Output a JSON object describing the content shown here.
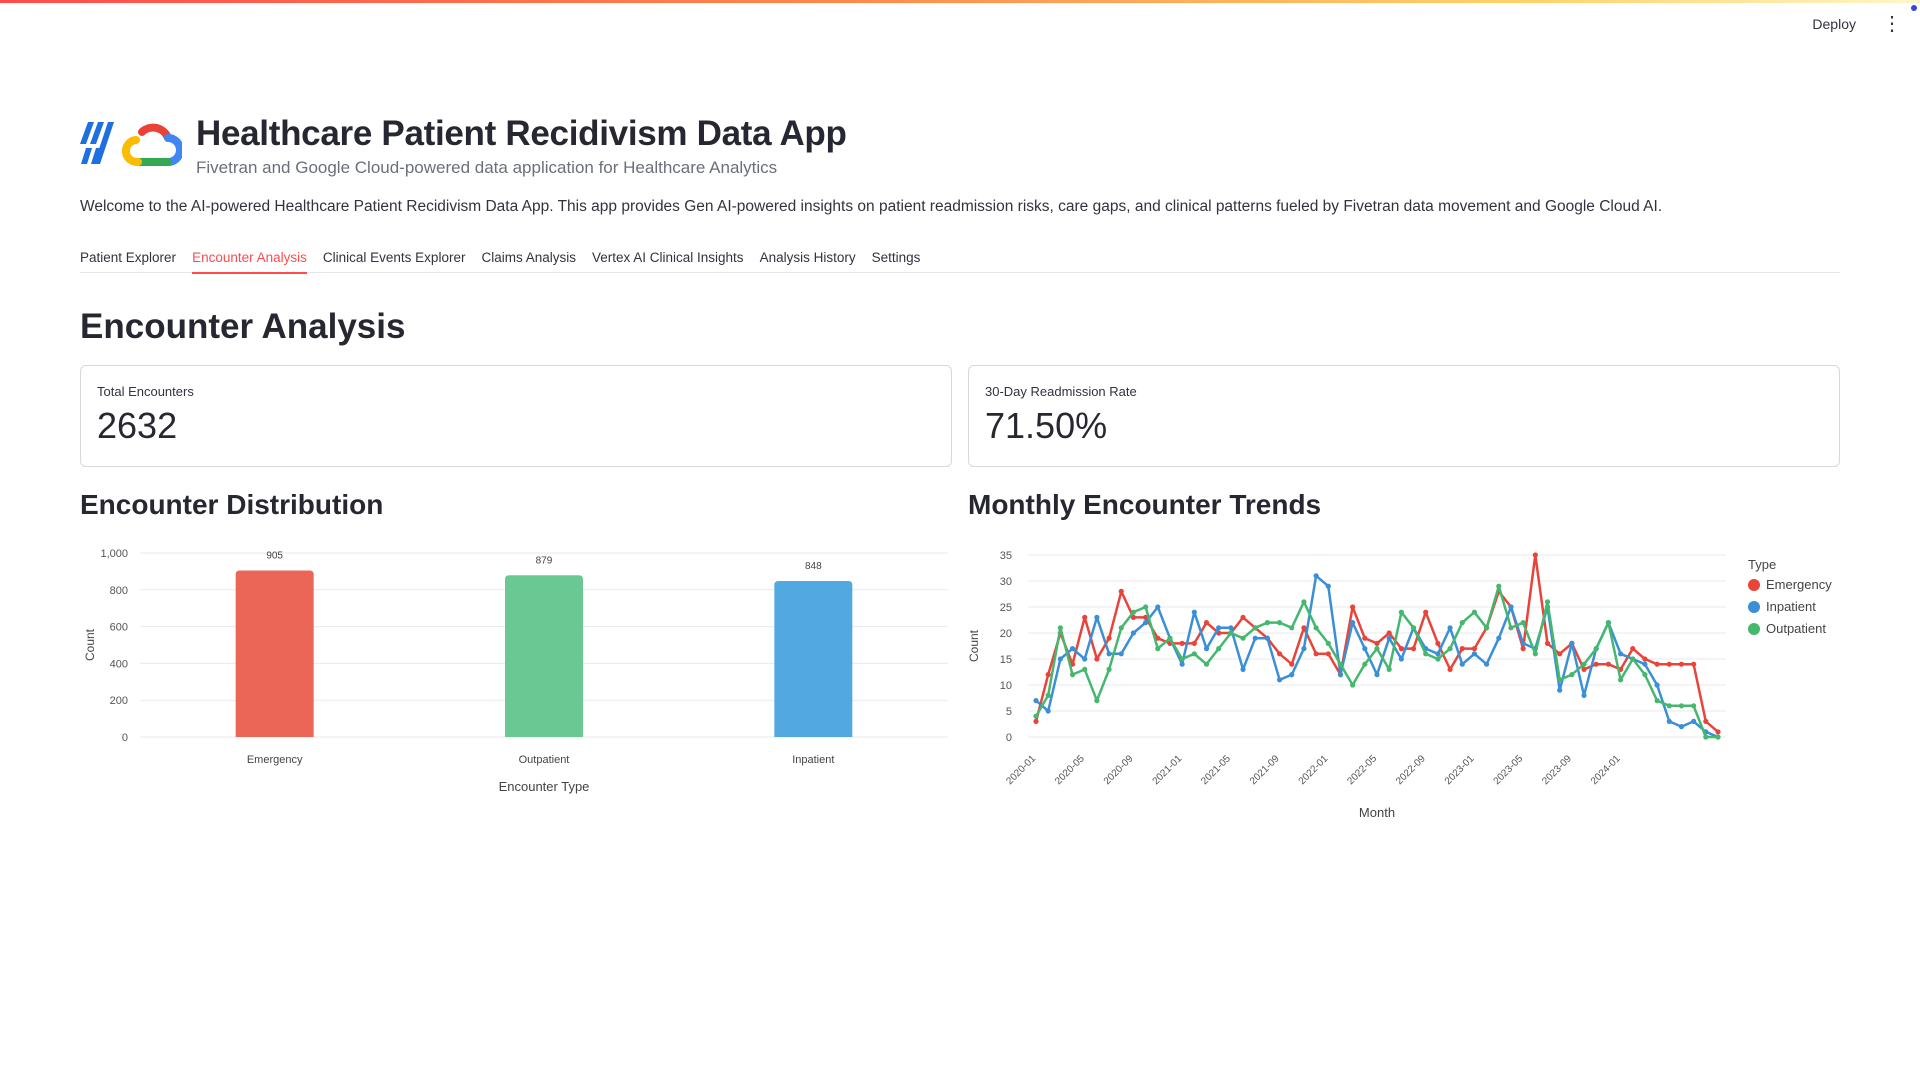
{
  "header": {
    "deploy_label": "Deploy",
    "menu_icon": "⋮"
  },
  "app": {
    "title": "Healthcare Patient Recidivism Data App",
    "subtitle": "Fivetran and Google Cloud-powered data application for Healthcare Analytics",
    "welcome": "Welcome to the AI-powered Healthcare Patient Recidivism Data App. This app provides Gen AI-powered insights on patient readmission risks, care gaps, and clinical patterns fueled by Fivetran data movement and Google Cloud AI."
  },
  "tabs": [
    {
      "label": "Patient Explorer"
    },
    {
      "label": "Encounter Analysis",
      "active": true
    },
    {
      "label": "Clinical Events Explorer"
    },
    {
      "label": "Claims Analysis"
    },
    {
      "label": "Vertex AI Clinical Insights"
    },
    {
      "label": "Analysis History"
    },
    {
      "label": "Settings"
    }
  ],
  "section": {
    "title": "Encounter Analysis"
  },
  "metrics": {
    "total_encounters": {
      "label": "Total Encounters",
      "value": "2632"
    },
    "readmission_rate": {
      "label": "30-Day Readmission Rate",
      "value": "71.50%"
    }
  },
  "charts": {
    "distribution_title": "Encounter Distribution",
    "trends_title": "Monthly Encounter Trends"
  },
  "chart_data": [
    {
      "type": "bar",
      "xlabel": "Encounter Type",
      "ylabel": "Count",
      "categories": [
        "Emergency",
        "Outpatient",
        "Inpatient"
      ],
      "values": [
        905,
        879,
        848
      ],
      "value_labels": [
        "905",
        "879",
        "848"
      ],
      "colors": [
        "#ec6657",
        "#6ac993",
        "#52a8e0"
      ],
      "yticks": [
        "0",
        "200",
        "400",
        "600",
        "800",
        "1,000"
      ],
      "ylim": [
        0,
        1000
      ],
      "grid": true
    },
    {
      "type": "line",
      "xlabel": "Month",
      "ylabel": "Count",
      "xticks": [
        "2020-01",
        "2020-05",
        "2020-09",
        "2021-01",
        "2021-05",
        "2021-09",
        "2022-01",
        "2022-05",
        "2022-09",
        "2023-01",
        "2023-05",
        "2023-09",
        "2024-01"
      ],
      "yticks": [
        "0",
        "5",
        "10",
        "15",
        "20",
        "25",
        "30",
        "35"
      ],
      "ylim": [
        0,
        35
      ],
      "x_start": "2020-01",
      "legend_title": "Type",
      "legend_position": "right",
      "grid": true,
      "series": [
        {
          "name": "Emergency",
          "color": "#e8443a",
          "values": [
            3,
            12,
            20,
            14,
            23,
            15,
            19,
            28,
            23,
            23,
            19,
            18,
            18,
            18,
            22,
            20,
            20,
            23,
            21,
            19,
            16,
            14,
            21,
            16,
            16,
            12,
            25,
            19,
            18,
            20,
            17,
            17,
            24,
            18,
            13,
            17,
            17,
            21,
            28,
            25,
            17,
            35,
            18,
            16,
            18,
            13,
            14,
            14,
            13,
            17,
            15,
            14,
            14,
            14,
            14,
            3,
            1
          ]
        },
        {
          "name": "Inpatient",
          "color": "#3a8fd6",
          "values": [
            7,
            5,
            15,
            17,
            15,
            23,
            16,
            16,
            20,
            22,
            25,
            19,
            14,
            24,
            17,
            21,
            21,
            13,
            19,
            19,
            11,
            12,
            17,
            31,
            29,
            12,
            22,
            17,
            12,
            19,
            15,
            21,
            17,
            16,
            21,
            14,
            16,
            14,
            19,
            25,
            18,
            17,
            25,
            9,
            18,
            8,
            17,
            22,
            16,
            15,
            14,
            10,
            3,
            2,
            3,
            1,
            0
          ]
        },
        {
          "name": "Outpatient",
          "color": "#45b76e",
          "values": [
            4,
            8,
            21,
            12,
            13,
            7,
            13,
            21,
            24,
            25,
            17,
            19,
            15,
            16,
            14,
            17,
            20,
            19,
            21,
            22,
            22,
            21,
            26,
            21,
            18,
            14,
            10,
            14,
            17,
            13,
            24,
            21,
            16,
            15,
            17,
            22,
            24,
            21,
            29,
            21,
            22,
            16,
            26,
            11,
            12,
            14,
            17,
            22,
            11,
            15,
            12,
            7,
            6,
            6,
            6,
            0,
            0
          ]
        }
      ]
    }
  ]
}
